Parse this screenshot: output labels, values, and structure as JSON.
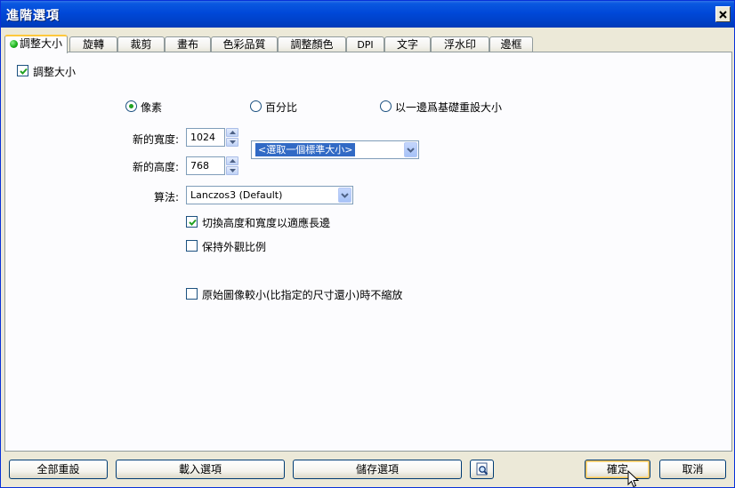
{
  "window": {
    "title": "進階選項"
  },
  "tabs": [
    {
      "label": "調整大小",
      "active": true
    },
    {
      "label": "旋轉"
    },
    {
      "label": "裁剪"
    },
    {
      "label": "畫布"
    },
    {
      "label": "色彩品質"
    },
    {
      "label": "調整顏色"
    },
    {
      "label": "DPI"
    },
    {
      "label": "文字"
    },
    {
      "label": "浮水印"
    },
    {
      "label": "邊框"
    }
  ],
  "resize": {
    "enable_label": "調整大小",
    "enabled": true,
    "mode_options": [
      {
        "label": "像素",
        "selected": true
      },
      {
        "label": "百分比",
        "selected": false
      },
      {
        "label": "以一邊爲基礎重設大小",
        "selected": false
      }
    ],
    "width_label": "新的寬度:",
    "width_value": "1024",
    "height_label": "新的高度:",
    "height_value": "768",
    "standard_size": "<選取一個標準大小>",
    "algorithm_label": "算法:",
    "algorithm_value": "Lanczos3 (Default)",
    "swap_label": "切換高度和寬度以適應長邊",
    "swap_checked": true,
    "aspect_label": "保持外觀比例",
    "aspect_checked": false,
    "no_enlarge_label": "原始圖像較小(比指定的尺寸還小)時不縮放",
    "no_enlarge_checked": false
  },
  "footer": {
    "reset_all": "全部重設",
    "load_options": "載入選項",
    "save_options": "儲存選項",
    "ok": "確定",
    "cancel": "取消"
  },
  "icons": {
    "close": "close-icon",
    "preview": "magnifier-preview-icon",
    "cursor": "mouse-pointer-icon"
  }
}
